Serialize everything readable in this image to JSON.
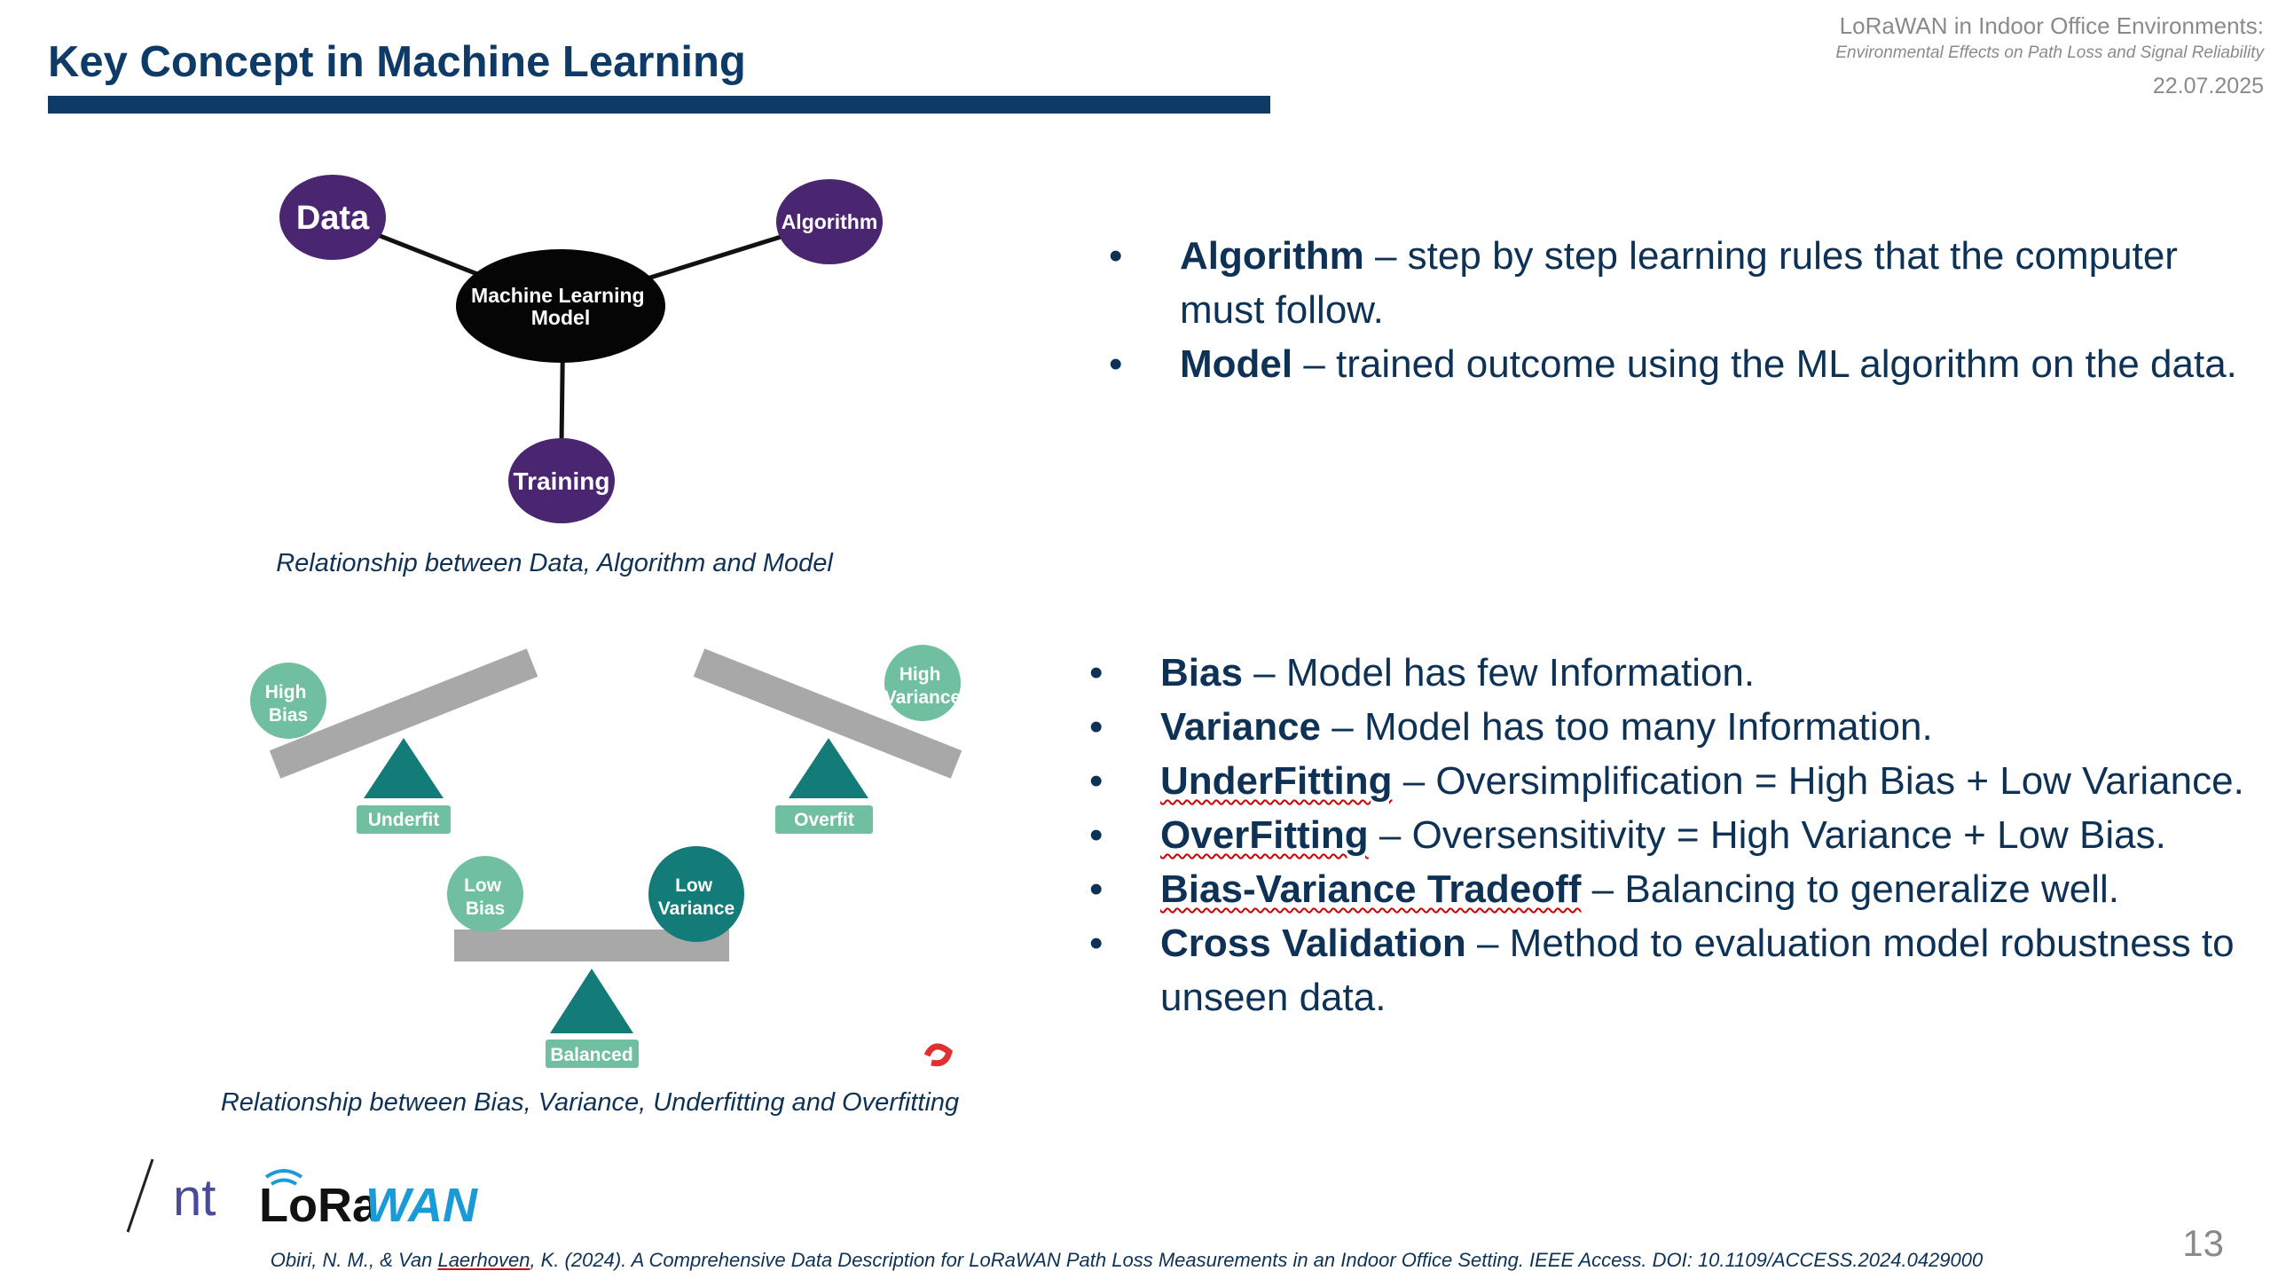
{
  "header": {
    "title": "Key Concept in Machine Learning",
    "right_line1": "LoRaWAN in Indoor Office Environments:",
    "right_line2": "Environmental Effects on Path Loss and Signal Reliability",
    "date": "22.07.2025"
  },
  "diagram_ml": {
    "center": "Machine Learning\nModel",
    "data": "Data",
    "algorithm": "Algorithm",
    "training": "Training",
    "caption": "Relationship between Data, Algorithm and Model"
  },
  "diagram_bias": {
    "underfit": {
      "ball": "High\nBias",
      "tag": "Underfit"
    },
    "overfit": {
      "ball": "High\nVariance",
      "tag": "Overfit"
    },
    "balanced": {
      "left_ball": "Low\nBias",
      "right_ball": "Low\nVariance",
      "tag": "Balanced"
    },
    "caption": "Relationship between Bias, Variance, Underfitting and Overfitting"
  },
  "bullets_top": [
    {
      "term": "Algorithm",
      "text": " – step by step learning rules that the computer must follow."
    },
    {
      "term": "Model",
      "text": " – trained outcome using the ML algorithm on the data."
    }
  ],
  "bullets_bottom": [
    {
      "term": "Bias",
      "text": " – Model has few Information."
    },
    {
      "term": "Variance",
      "text": " – Model has too many Information."
    },
    {
      "term": "UnderFitting",
      "text": " – Oversimplification = High Bias + Low Variance."
    },
    {
      "term": "OverFitting",
      "text": " – Oversensitivity = High Variance + Low Bias."
    },
    {
      "term": "Bias-Variance Tradeoff",
      "text": " – Balancing to generalize well."
    },
    {
      "term": "Cross Validation",
      "text": " – Method to evaluation model robustness to unseen data."
    }
  ],
  "footer": {
    "ref_part1": "Obiri, N. M., & Van ",
    "ref_underlined": "Laerhoven",
    "ref_part2": ", K. (2024). A Comprehensive Data Description for LoRaWAN Path Loss Measurements in an Indoor Office Setting. IEEE Access. DOI: 10.1109/ACCESS.2024.0429000",
    "page_number": "13",
    "logo_text_lora": "LoRa",
    "logo_text_wan": "WAN",
    "logo_text_group": "nt"
  },
  "colors": {
    "navy": "#0d3a66",
    "purple": "#4a2670",
    "teal": "#137b78",
    "light_teal": "#6fbfa0",
    "beam": "#a8a8a8",
    "lora_blue": "#1a9ad6"
  }
}
